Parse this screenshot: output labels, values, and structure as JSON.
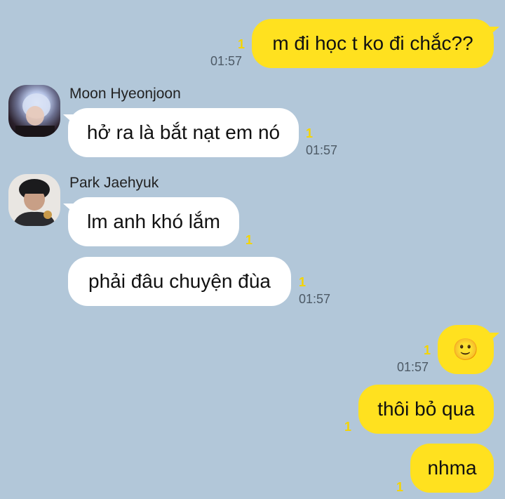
{
  "messages": [
    {
      "side": "me",
      "text": "m đi học t ko đi chắc??",
      "unread": "1",
      "time": "01:57"
    },
    {
      "side": "other",
      "sender": "Moon Hyeonjoon",
      "text": "hở ra là bắt nạt em nó",
      "unread": "1",
      "time": "01:57"
    },
    {
      "side": "other",
      "sender": "Park Jaehyuk",
      "text": "lm anh khó lắm",
      "unread": "1"
    },
    {
      "side": "other",
      "text": "phải đâu chuyện đùa",
      "unread": "1",
      "time": "01:57"
    },
    {
      "side": "me",
      "text": "🙂",
      "unread": "1",
      "time": "01:57"
    },
    {
      "side": "me",
      "text": "thôi bỏ qua",
      "unread": "1"
    },
    {
      "side": "me",
      "text": "nhma",
      "unread": "1"
    }
  ],
  "avatars": {
    "moon": "avatar-moon-hyeonjoon",
    "park": "avatar-park-jaehyuk"
  },
  "colors": {
    "background": "#b2c7d9",
    "my_bubble": "#ffe11f",
    "other_bubble": "#ffffff",
    "unread": "#f5d400"
  }
}
